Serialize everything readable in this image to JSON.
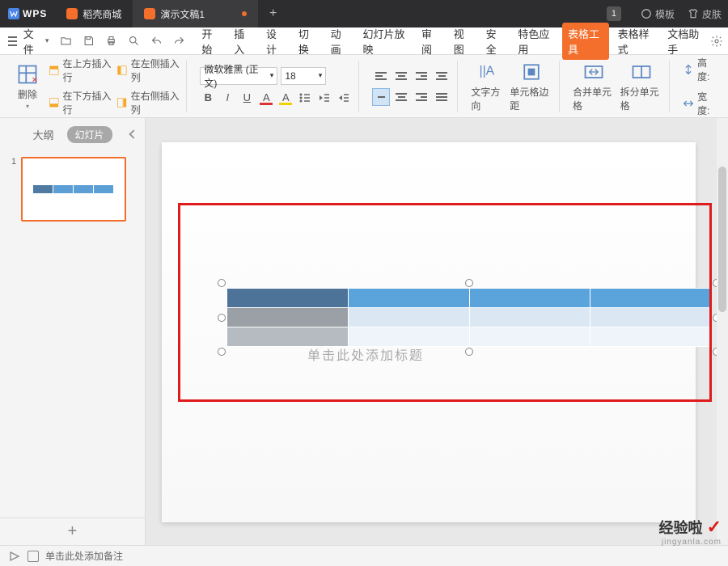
{
  "titlebar": {
    "app": "WPS",
    "tabs": [
      {
        "icon": "orange",
        "label": "稻壳商城",
        "active": false
      },
      {
        "icon": "orange",
        "label": "演示文稿1",
        "active": true
      }
    ],
    "badge": "1",
    "right": {
      "template": "模板",
      "skin": "皮肤"
    }
  },
  "menu": {
    "file": "文件",
    "items": [
      "开始",
      "插入",
      "设计",
      "切换",
      "动画",
      "幻灯片放映",
      "审阅",
      "视图",
      "安全",
      "特色应用",
      "表格工具",
      "表格样式",
      "文档助手"
    ],
    "highlight_index": 10
  },
  "ribbon": {
    "delete": "删除",
    "ins_above": "在上方插入行",
    "ins_below": "在下方插入行",
    "ins_left": "在左侧插入列",
    "ins_right": "在右侧插入列",
    "font_name": "微软雅黑 (正文)",
    "font_size": "18",
    "text_dir": "文字方向",
    "cell_margin": "单元格边距",
    "merge": "合并单元格",
    "split": "拆分单元格",
    "height": "高度:",
    "width": "宽度:"
  },
  "side": {
    "outline": "大纲",
    "slides": "幻灯片",
    "num1": "1"
  },
  "canvas": {
    "placeholder_partial": "单击此处添加标题",
    "notes": "单击此处添加备注"
  },
  "watermark": {
    "t1": "经验啦",
    "t2": "jingyanla.com"
  }
}
